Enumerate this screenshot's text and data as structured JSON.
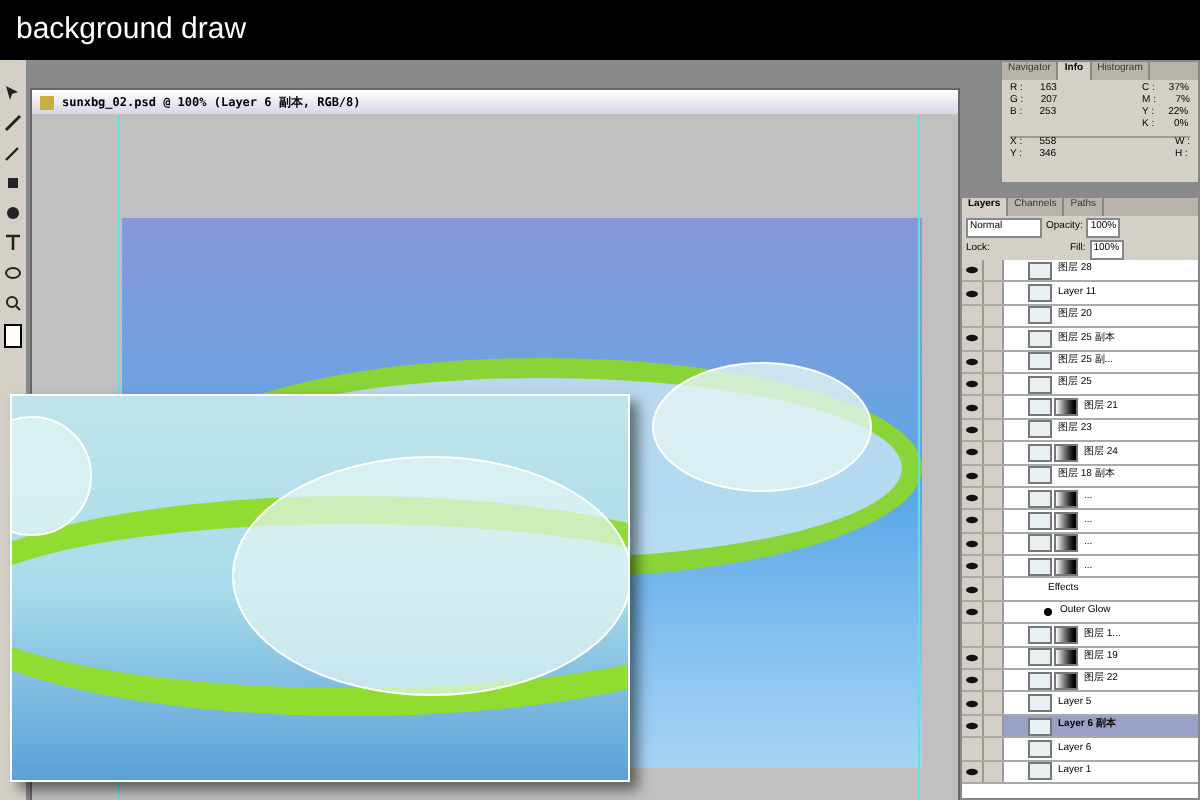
{
  "header": {
    "title": "background draw"
  },
  "document": {
    "title": "sunxbg_02.psd @ 100% (Layer 6 副本, RGB/8)"
  },
  "info_panel": {
    "tabs": [
      {
        "label": "Navigator",
        "selected": false
      },
      {
        "label": "Info",
        "selected": true
      },
      {
        "label": "Histogram",
        "selected": false
      }
    ],
    "rgb": [
      {
        "label": "R :",
        "value": "163"
      },
      {
        "label": "G :",
        "value": "207"
      },
      {
        "label": "B :",
        "value": "253"
      }
    ],
    "cmyk": [
      {
        "label": "C :",
        "value": "37%"
      },
      {
        "label": "M :",
        "value": "7%"
      },
      {
        "label": "Y :",
        "value": "22%"
      },
      {
        "label": "K :",
        "value": "0%"
      }
    ],
    "xy": [
      {
        "label": "X :",
        "value": "558"
      },
      {
        "label": "Y :",
        "value": "346"
      }
    ],
    "wh": [
      {
        "label": "W :"
      },
      {
        "label": "H :"
      }
    ]
  },
  "layers_panel": {
    "tabs": [
      {
        "label": "Layers",
        "selected": true
      },
      {
        "label": "Channels",
        "selected": false
      },
      {
        "label": "Paths",
        "selected": false
      }
    ],
    "blend_mode": "Normal",
    "opacity_label": "Opacity:",
    "opacity": "100%",
    "lock_label": "Lock:",
    "fill_label": "Fill:",
    "fill": "100%",
    "layers": [
      {
        "kind": "layer",
        "name": "图层 28",
        "visible": true,
        "selected": false
      },
      {
        "kind": "layer",
        "name": "Layer 11",
        "visible": true,
        "selected": false
      },
      {
        "kind": "layer",
        "name": "图层 20",
        "visible": false,
        "selected": false
      },
      {
        "kind": "layer",
        "name": "图层 25 副本",
        "visible": true,
        "selected": false
      },
      {
        "kind": "layer",
        "name": "图层 25 副...",
        "visible": true,
        "selected": false
      },
      {
        "kind": "layer",
        "name": "图层 25",
        "visible": true,
        "selected": false
      },
      {
        "kind": "masked",
        "name": "图层 21",
        "visible": true,
        "selected": false
      },
      {
        "kind": "layer",
        "name": "图层 23",
        "visible": true,
        "selected": false
      },
      {
        "kind": "masked",
        "name": "图层 24",
        "visible": true,
        "selected": false
      },
      {
        "kind": "layer",
        "name": "图层 18 副本",
        "visible": true,
        "selected": false
      },
      {
        "kind": "masked",
        "name": "...",
        "visible": true,
        "selected": false
      },
      {
        "kind": "masked",
        "name": "...",
        "visible": true,
        "selected": false
      },
      {
        "kind": "masked",
        "name": "...",
        "visible": true,
        "selected": false
      },
      {
        "kind": "masked",
        "name": "...",
        "visible": true,
        "selected": false
      },
      {
        "kind": "effects",
        "name": "Effects",
        "visible": true,
        "selected": false
      },
      {
        "kind": "effect",
        "name": "Outer Glow",
        "visible": true,
        "selected": false
      },
      {
        "kind": "masked",
        "name": "图层 1...",
        "visible": false,
        "selected": false
      },
      {
        "kind": "masked",
        "name": "图层 19",
        "visible": true,
        "selected": false
      },
      {
        "kind": "masked",
        "name": "图层 22",
        "visible": true,
        "selected": false
      },
      {
        "kind": "layer",
        "name": "Layer 5",
        "visible": true,
        "selected": false
      },
      {
        "kind": "layer",
        "name": "Layer 6 副本",
        "visible": true,
        "selected": true
      },
      {
        "kind": "layer",
        "name": "Layer 6",
        "visible": false,
        "selected": false
      },
      {
        "kind": "layer",
        "name": "Layer 1",
        "visible": true,
        "selected": false
      }
    ]
  }
}
